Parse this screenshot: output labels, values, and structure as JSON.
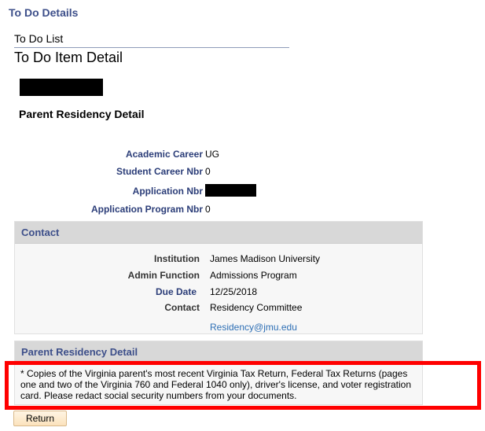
{
  "header": {
    "page_title": "To Do Details",
    "breadcrumb": "To Do List",
    "item_title": "To Do Item Detail",
    "section_title": "Parent Residency Detail"
  },
  "student_info": {
    "fields": [
      {
        "label": "Academic Career",
        "value": "UG"
      },
      {
        "label": "Student Career Nbr",
        "value": "0"
      },
      {
        "label": "Application Nbr",
        "value": "[redacted]"
      },
      {
        "label": "Application Program Nbr",
        "value": "0"
      }
    ]
  },
  "contact": {
    "heading": "Contact",
    "fields": [
      {
        "label": "Institution",
        "value": "James Madison University"
      },
      {
        "label": "Admin Function",
        "value": "Admissions Program"
      },
      {
        "label": "Due Date",
        "value": "12/25/2018"
      },
      {
        "label": "Contact",
        "value": "Residency Committee"
      }
    ],
    "email": "Residency@jmu.edu"
  },
  "detail": {
    "heading": "Parent Residency Detail",
    "description": "* Copies of the Virginia parent's most recent Virginia Tax Return, Federal Tax Returns (pages one and two of the Virginia 760 and Federal 1040 only), driver's license, and voter registration card. Please redact social security numbers from your documents."
  },
  "actions": {
    "return_label": "Return"
  },
  "colors": {
    "title_blue": "#3d4f8a",
    "label_blue": "#2b3d78",
    "link_blue": "#2e6fb5",
    "highlight_red": "#ff0000",
    "button_bg": "#fbe2bc"
  }
}
